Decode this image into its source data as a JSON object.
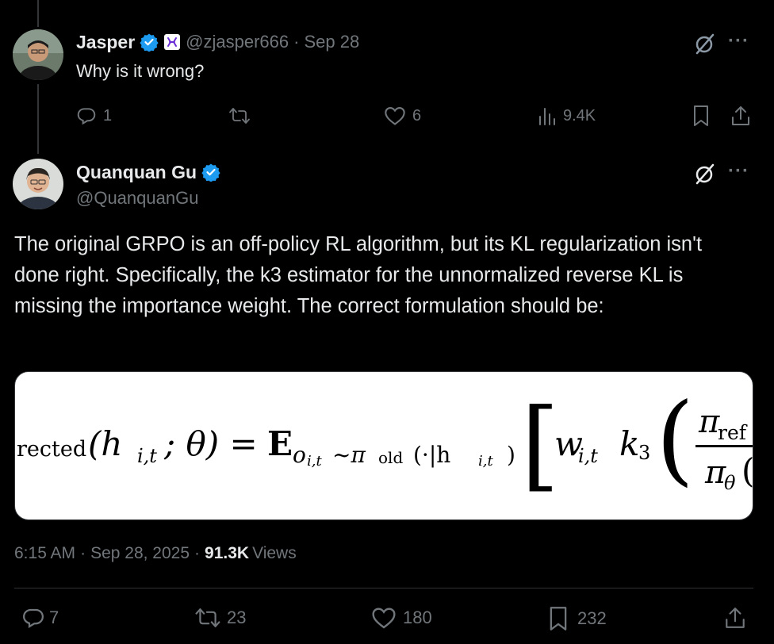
{
  "reply_tweet": {
    "author_name": "Jasper",
    "handle": "@zjasper666",
    "date": "Sep 28",
    "text": "Why is it wrong?",
    "replies": "1",
    "reposts": "",
    "likes": "6",
    "views": "9.4K"
  },
  "main_tweet": {
    "author_name": "Quanquan Gu",
    "handle": "@QuanquanGu",
    "text": "The original GRPO is an off-policy RL algorithm, but its KL regularization isn't done right. Specifically, the k3 estimator for the unnormalized reverse KL is missing the importance weight. The correct formulation should be:",
    "timestamp": "6:15 AM",
    "date": "Sep 28, 2025",
    "views_count": "91.3K",
    "views_label": "Views",
    "replies": "7",
    "reposts": "23",
    "likes": "180",
    "bookmarks": "232"
  },
  "formula": {
    "lhs_fragment": "rected",
    "lhs_args": "(h",
    "sub_it": "i,t",
    "theta_part": "; θ) = ",
    "expect": "E",
    "expect_sub": "o",
    "expect_sub2": "i,t",
    "sim": "~π",
    "old": "old",
    "cond": "(·|h",
    "cond_sub": "i,t",
    "cond_close": ")",
    "bracket": "[",
    "w": "w",
    "w_sub": "i,t",
    "k3": "k",
    "k3_sub": "3",
    "paren": "(",
    "num": "π",
    "num_sub": "ref",
    "den": "π",
    "den_sub": "θ",
    "den_paren": "("
  },
  "colors": {
    "background": "#000000",
    "text": "#e7e9ea",
    "muted": "#71767b",
    "verified": "#1d9bf0",
    "divider": "#2f3336"
  },
  "icons": {
    "verified": "verified-badge-icon",
    "affiliate": "affiliate-badge-icon",
    "grok": "grok-icon",
    "more": "more-icon",
    "reply": "reply-icon",
    "repost": "repost-icon",
    "like": "like-icon",
    "views": "views-icon",
    "bookmark": "bookmark-icon",
    "share": "share-icon"
  }
}
